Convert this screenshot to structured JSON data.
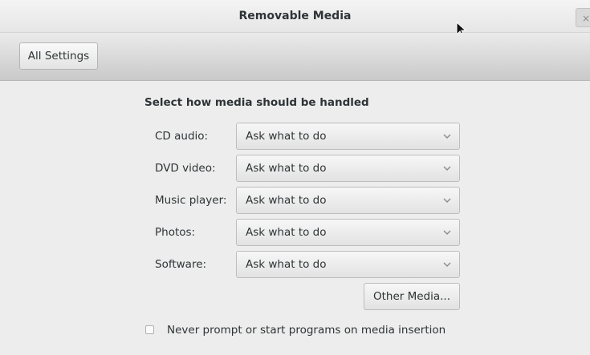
{
  "window": {
    "title": "Removable Media",
    "close_glyph": "×"
  },
  "toolbar": {
    "all_settings_label": "All Settings"
  },
  "main": {
    "heading": "Select how media should be handled",
    "rows": [
      {
        "label": "CD audio:",
        "value": "Ask what to do"
      },
      {
        "label": "DVD video:",
        "value": "Ask what to do"
      },
      {
        "label": "Music player:",
        "value": "Ask what to do"
      },
      {
        "label": "Photos:",
        "value": "Ask what to do"
      },
      {
        "label": "Software:",
        "value": "Ask what to do"
      }
    ],
    "other_media_label": "Other Media...",
    "never_prompt": {
      "label": "Never prompt or start programs on media insertion",
      "checked": false
    }
  },
  "icons": {
    "combo_arrow": "chevron-down-icon",
    "cursor": "mouse-pointer-icon",
    "close": "close-icon"
  }
}
